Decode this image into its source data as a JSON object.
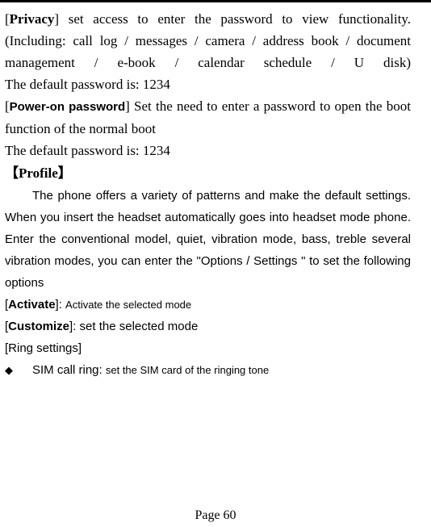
{
  "document": {
    "privacy": {
      "tag_open": "[",
      "tag_bold": "Privacy",
      "tag_close": "]",
      "body": " set access to enter the password to view functionality. (Including: call log / messages / camera / address book / document management / e-book / calendar schedule / U disk)"
    },
    "privacy_default": "The default password is: 1234",
    "poweron": {
      "tag_open": "[",
      "tag_bold": "Power-on password",
      "tag_close": "]",
      "body": " Set the need to enter a password to open the boot function of the normal boot"
    },
    "poweron_default": "The default password is: 1234",
    "profile_heading": "【Profile】",
    "profile_body": "The phone offers a variety of patterns and make the default settings. When you insert the headset automatically goes into headset mode phone. Enter the conventional model, quiet, vibration mode, bass, treble several vibration modes, you can enter the \"Options / Settings \" to set the following options",
    "activate": {
      "tag_open": "[",
      "tag_bold": "Activate",
      "tag_close": "]: ",
      "body": "Activate the selected mode"
    },
    "customize": {
      "tag_open": "[",
      "tag_bold": "Customize",
      "tag_close": "]: ",
      "body": "set the selected mode"
    },
    "ring_settings": "[Ring settings]",
    "sim_call_ring": {
      "bullet": "◆",
      "label": "SIM call ring: ",
      "body": "set the SIM card of the ringing tone"
    },
    "page_footer": "Page 60"
  }
}
